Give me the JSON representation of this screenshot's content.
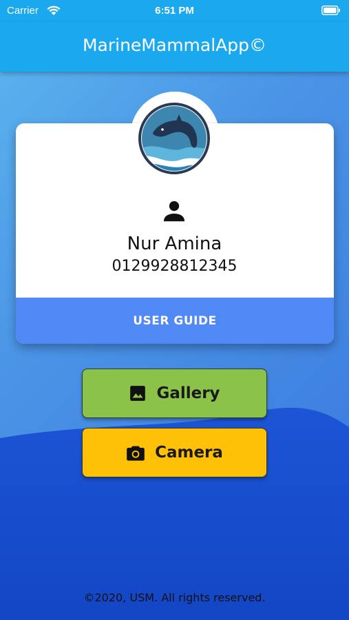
{
  "status_bar": {
    "carrier": "Carrier",
    "time": "6:51 PM"
  },
  "app_bar": {
    "title": "MarineMammalApp©"
  },
  "profile": {
    "name": "Nur Amina",
    "phone": "0129928812345",
    "guide_label": "USER GUIDE"
  },
  "actions": {
    "gallery_label": "Gallery",
    "camera_label": "Camera"
  },
  "footer": {
    "text": "©2020, USM. All rights reserved."
  },
  "colors": {
    "app_bar": "#1aa8ee",
    "guide": "#5089f6",
    "gallery": "#8bc34a",
    "camera": "#ffc107",
    "wave": "#1a4fd0"
  },
  "icons": [
    "wifi-icon",
    "battery-icon",
    "dolphin-logo-icon",
    "person-icon",
    "image-icon",
    "camera-icon"
  ]
}
